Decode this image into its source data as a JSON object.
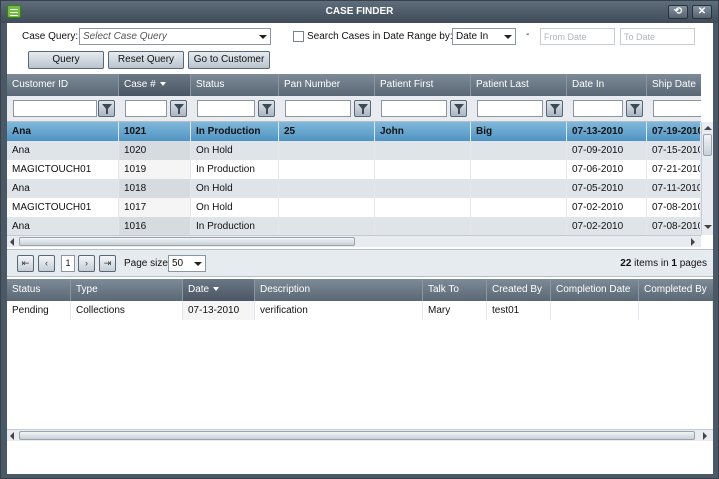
{
  "window": {
    "title": "CASE FINDER",
    "refresh_glyph": "⟲",
    "close_glyph": "✕"
  },
  "query": {
    "case_query_label": "Case Query:",
    "case_query_placeholder": "Select Case Query",
    "date_range_label": "Search Cases in Date Range by:",
    "date_range_value": "Date In",
    "dash": "-",
    "from_date_placeholder": "From Date",
    "to_date_placeholder": "To Date",
    "query_button": "Query",
    "reset_button": "Reset Query",
    "goto_button": "Go to Customer"
  },
  "cases": {
    "columns": [
      "Customer ID",
      "Case #",
      "Status",
      "Pan Number",
      "Patient First",
      "Patient Last",
      "Date In",
      "Ship Date"
    ],
    "rows": [
      [
        "Ana",
        "1021",
        "In Production",
        "25",
        "John",
        "Big",
        "07-13-2010",
        "07-19-2010"
      ],
      [
        "Ana",
        "1020",
        "On Hold",
        "",
        "",
        "",
        "07-09-2010",
        "07-15-2010"
      ],
      [
        "MAGICTOUCH01",
        "1019",
        "In Production",
        "",
        "",
        "",
        "07-06-2010",
        "07-21-2010"
      ],
      [
        "Ana",
        "1018",
        "On Hold",
        "",
        "",
        "",
        "07-05-2010",
        "07-11-2010"
      ],
      [
        "MAGICTOUCH01",
        "1017",
        "On Hold",
        "",
        "",
        "",
        "07-02-2010",
        "07-08-2010"
      ],
      [
        "Ana",
        "1016",
        "In Production",
        "",
        "",
        "",
        "07-02-2010",
        "07-08-2010"
      ]
    ]
  },
  "pager": {
    "first_glyph": "⇤",
    "prev_glyph": "‹",
    "next_glyph": "›",
    "last_glyph": "⇥",
    "current_page": "1",
    "page_size_label": "Page size:",
    "page_size_value": "50",
    "total_items": "22",
    "items_in_label": "items in",
    "total_pages": "1",
    "pages_label": "pages"
  },
  "history": {
    "columns": [
      "Status",
      "Type",
      "Date",
      "Description",
      "Talk To",
      "Created By",
      "Completion Date",
      "Completed By"
    ],
    "rows": [
      [
        "Pending",
        "Collections",
        "07-13-2010",
        "verification",
        "Mary",
        "test01",
        "",
        ""
      ]
    ]
  },
  "colors": {
    "selected_row": "#5a9fcb",
    "header": "#6b7886",
    "title_bar": "#4b5866"
  }
}
